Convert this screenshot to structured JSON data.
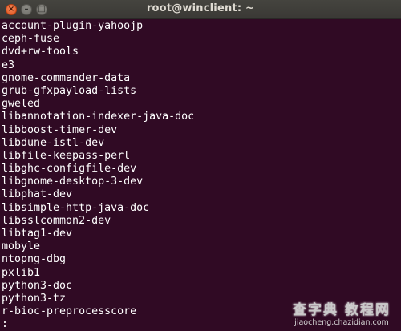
{
  "window": {
    "title": "root@winclient: ~",
    "close_glyph": "×",
    "minimize_glyph": "–",
    "maximize_glyph": "□"
  },
  "terminal": {
    "lines": [
      "account-plugin-yahoojp",
      "ceph-fuse",
      "dvd+rw-tools",
      "e3",
      "gnome-commander-data",
      "grub-gfxpayload-lists",
      "gweled",
      "libannotation-indexer-java-doc",
      "libboost-timer-dev",
      "libdune-istl-dev",
      "libfile-keepass-perl",
      "libghc-configfile-dev",
      "libgnome-desktop-3-dev",
      "libphat-dev",
      "libsimple-http-java-doc",
      "libsslcommon2-dev",
      "libtag1-dev",
      "mobyle",
      "ntopng-dbg",
      "pxlib1",
      "python3-doc",
      "python3-tz",
      "r-bioc-preprocesscore"
    ],
    "prompt": ":"
  },
  "watermark": {
    "main": "查字典 教程网",
    "sub": "jiaocheng.chazidian.com"
  },
  "colors": {
    "terminal_bg": "#300a24",
    "titlebar_bg": "#3c3b37",
    "close_button": "#e95420",
    "text": "#ffffff"
  }
}
